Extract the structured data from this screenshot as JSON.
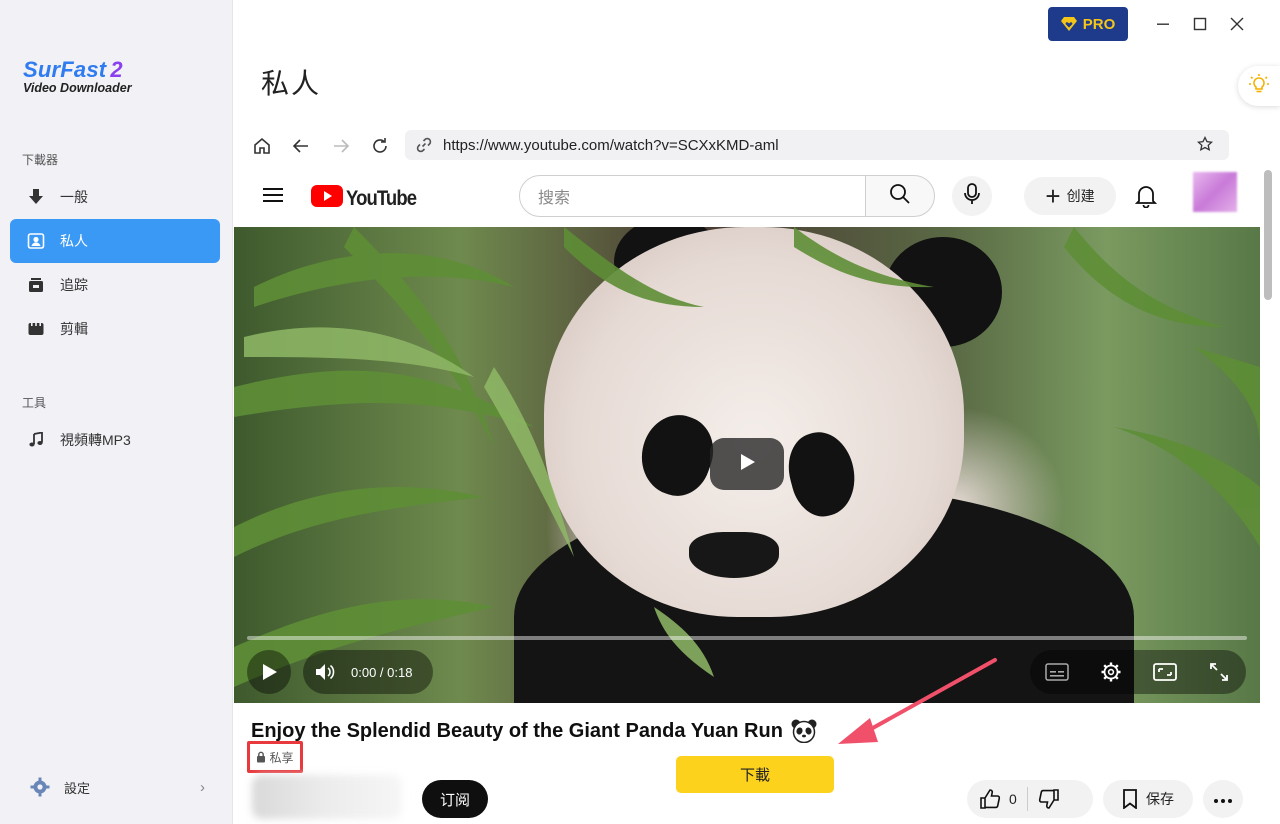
{
  "app": {
    "logo_name": "SurFast",
    "logo_version": "2",
    "logo_subtitle": "Video Downloader",
    "pro_label": "PRO",
    "page_title": "私人"
  },
  "sidebar": {
    "section_downloader": "下載器",
    "section_tools": "工具",
    "items": [
      {
        "label": "一般",
        "icon": "download-arrow-icon"
      },
      {
        "label": "私人",
        "icon": "private-user-icon",
        "active": true
      },
      {
        "label": "追踪",
        "icon": "track-icon"
      },
      {
        "label": "剪輯",
        "icon": "clip-icon"
      }
    ],
    "tools": [
      {
        "label": "視頻轉MP3",
        "icon": "music-note-icon"
      }
    ],
    "settings_label": "設定"
  },
  "browser": {
    "url": "https://www.youtube.com/watch?v=SCXxKMD-aml"
  },
  "youtube": {
    "logo_text": "YouTube",
    "search_placeholder": "搜索",
    "create_label": "创建",
    "video": {
      "time": "0:00 / 0:18",
      "progress": 0
    },
    "title": "Enjoy the Splendid Beauty of the Giant Panda Yuan Run",
    "privacy_label": "私享",
    "subscribe_label": "订阅",
    "like_count": "0",
    "save_label": "保存"
  },
  "download_label": "下載",
  "colors": {
    "accent": "#3a99f5",
    "download_button": "#fcd21d",
    "pro_bg": "#1e3a8a",
    "highlight": "#e8393c"
  }
}
